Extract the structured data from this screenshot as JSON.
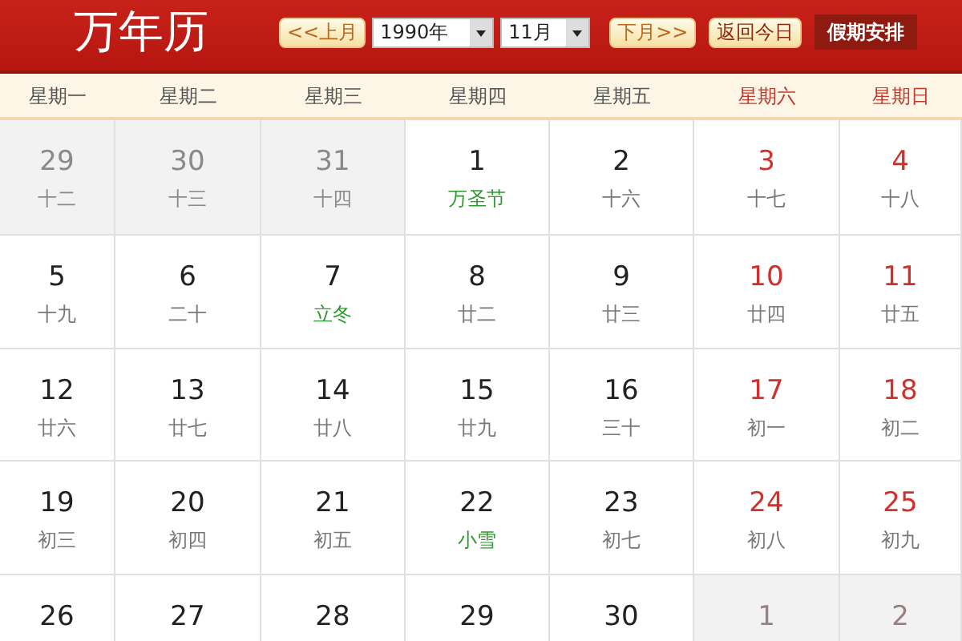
{
  "logo": "万年历",
  "nav": {
    "prev": "<<上月",
    "year": "1990年",
    "month": "11月",
    "next": "下月>>",
    "today": "返回今日",
    "holidays": "假期安排"
  },
  "weekdays": [
    {
      "label": "星期一",
      "weekend": false
    },
    {
      "label": "星期二",
      "weekend": false
    },
    {
      "label": "星期三",
      "weekend": false
    },
    {
      "label": "星期四",
      "weekend": false
    },
    {
      "label": "星期五",
      "weekend": false
    },
    {
      "label": "星期六",
      "weekend": true
    },
    {
      "label": "星期日",
      "weekend": true
    }
  ],
  "weeks": [
    [
      {
        "day": "29",
        "note": {
          "text": "十二",
          "kind": "lunar"
        },
        "other_month": true,
        "weekend": false
      },
      {
        "day": "30",
        "note": {
          "text": "十三",
          "kind": "lunar"
        },
        "other_month": true,
        "weekend": false
      },
      {
        "day": "31",
        "note": {
          "text": "十四",
          "kind": "lunar"
        },
        "other_month": true,
        "weekend": false
      },
      {
        "day": "1",
        "note": {
          "text": "万圣节",
          "kind": "festival"
        },
        "other_month": false,
        "weekend": false
      },
      {
        "day": "2",
        "note": {
          "text": "十六",
          "kind": "lunar"
        },
        "other_month": false,
        "weekend": false
      },
      {
        "day": "3",
        "note": {
          "text": "十七",
          "kind": "lunar"
        },
        "other_month": false,
        "weekend": true
      },
      {
        "day": "4",
        "note": {
          "text": "十八",
          "kind": "lunar"
        },
        "other_month": false,
        "weekend": true
      }
    ],
    [
      {
        "day": "5",
        "note": {
          "text": "十九",
          "kind": "lunar"
        },
        "other_month": false,
        "weekend": false
      },
      {
        "day": "6",
        "note": {
          "text": "二十",
          "kind": "lunar"
        },
        "other_month": false,
        "weekend": false
      },
      {
        "day": "7",
        "note": {
          "text": "立冬",
          "kind": "festival"
        },
        "other_month": false,
        "weekend": false
      },
      {
        "day": "8",
        "note": {
          "text": "廿二",
          "kind": "lunar"
        },
        "other_month": false,
        "weekend": false
      },
      {
        "day": "9",
        "note": {
          "text": "廿三",
          "kind": "lunar"
        },
        "other_month": false,
        "weekend": false
      },
      {
        "day": "10",
        "note": {
          "text": "廿四",
          "kind": "lunar"
        },
        "other_month": false,
        "weekend": true
      },
      {
        "day": "11",
        "note": {
          "text": "廿五",
          "kind": "lunar"
        },
        "other_month": false,
        "weekend": true
      }
    ],
    [
      {
        "day": "12",
        "note": {
          "text": "廿六",
          "kind": "lunar"
        },
        "other_month": false,
        "weekend": false
      },
      {
        "day": "13",
        "note": {
          "text": "廿七",
          "kind": "lunar"
        },
        "other_month": false,
        "weekend": false
      },
      {
        "day": "14",
        "note": {
          "text": "廿八",
          "kind": "lunar"
        },
        "other_month": false,
        "weekend": false
      },
      {
        "day": "15",
        "note": {
          "text": "廿九",
          "kind": "lunar"
        },
        "other_month": false,
        "weekend": false
      },
      {
        "day": "16",
        "note": {
          "text": "三十",
          "kind": "lunar"
        },
        "other_month": false,
        "weekend": false
      },
      {
        "day": "17",
        "note": {
          "text": "初一",
          "kind": "lunar"
        },
        "other_month": false,
        "weekend": true
      },
      {
        "day": "18",
        "note": {
          "text": "初二",
          "kind": "lunar"
        },
        "other_month": false,
        "weekend": true
      }
    ],
    [
      {
        "day": "19",
        "note": {
          "text": "初三",
          "kind": "lunar"
        },
        "other_month": false,
        "weekend": false
      },
      {
        "day": "20",
        "note": {
          "text": "初四",
          "kind": "lunar"
        },
        "other_month": false,
        "weekend": false
      },
      {
        "day": "21",
        "note": {
          "text": "初五",
          "kind": "lunar"
        },
        "other_month": false,
        "weekend": false
      },
      {
        "day": "22",
        "note": {
          "text": "小雪",
          "kind": "festival"
        },
        "other_month": false,
        "weekend": false
      },
      {
        "day": "23",
        "note": {
          "text": "初七",
          "kind": "lunar"
        },
        "other_month": false,
        "weekend": false
      },
      {
        "day": "24",
        "note": {
          "text": "初八",
          "kind": "lunar"
        },
        "other_month": false,
        "weekend": true
      },
      {
        "day": "25",
        "note": {
          "text": "初九",
          "kind": "lunar"
        },
        "other_month": false,
        "weekend": true
      }
    ],
    [
      {
        "day": "26",
        "other_month": false,
        "weekend": false
      },
      {
        "day": "27",
        "other_month": false,
        "weekend": false
      },
      {
        "day": "28",
        "other_month": false,
        "weekend": false
      },
      {
        "day": "29",
        "other_month": false,
        "weekend": false
      },
      {
        "day": "30",
        "other_month": false,
        "weekend": false
      },
      {
        "day": "1",
        "other_month": true,
        "weekend": true
      },
      {
        "day": "2",
        "other_month": true,
        "weekend": true
      }
    ]
  ]
}
